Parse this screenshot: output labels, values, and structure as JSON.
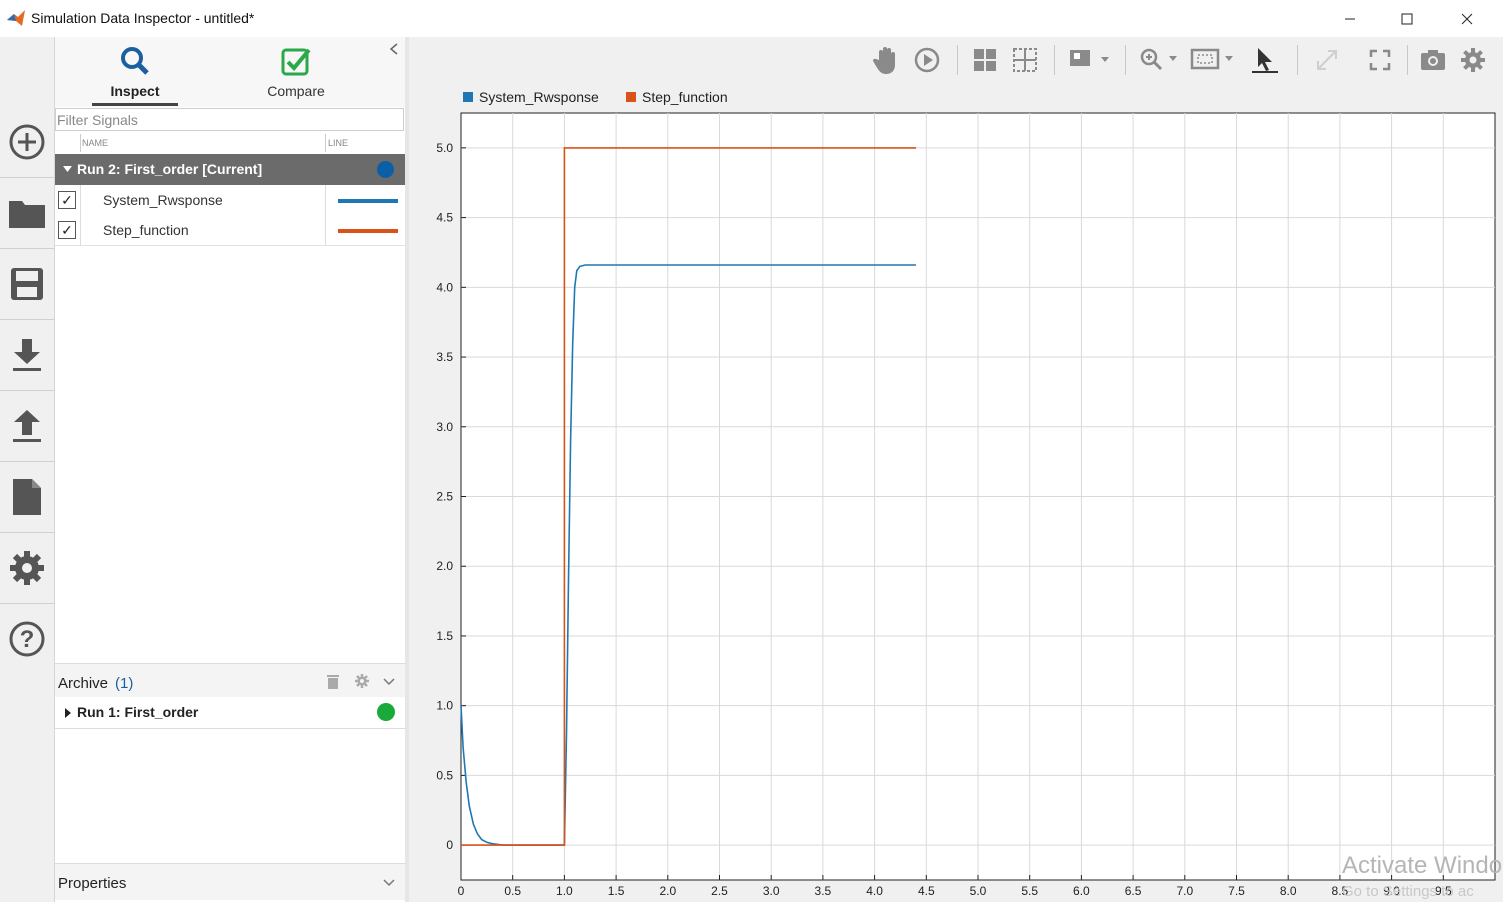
{
  "window": {
    "title": "Simulation Data Inspector - untitled*"
  },
  "tabs": [
    {
      "label": "Inspect"
    },
    {
      "label": "Compare"
    }
  ],
  "filter": {
    "placeholder": "Filter Signals"
  },
  "columns": {
    "name": "NAME",
    "line": "LINE"
  },
  "current_run": {
    "label": "Run 2: First_order [Current]",
    "color": "#0a5fa6",
    "signals": [
      {
        "name": "System_Rwsponse",
        "checked": true,
        "color": "#1f77b4"
      },
      {
        "name": "Step_function",
        "checked": true,
        "color": "#d95319"
      }
    ]
  },
  "archive": {
    "label": "Archive",
    "count": "(1)"
  },
  "archived_runs": [
    {
      "label": "Run 1: First_order",
      "color": "#1aaa3b"
    }
  ],
  "properties": {
    "label": "Properties"
  },
  "left_toolbar": [
    "new-run-icon",
    "open-folder-icon",
    "save-icon",
    "import-icon",
    "export-icon",
    "report-icon",
    "settings-icon",
    "help-icon"
  ],
  "plot_toolbar": [
    "pan-icon",
    "replay-icon",
    "layout-icon",
    "grid-icon",
    "subplot-icon",
    "zoom-icon",
    "fit-icon",
    "cursor-icon",
    "expand-icon",
    "fullscreen-icon",
    "snapshot-icon",
    "plot-settings-icon"
  ],
  "watermark": {
    "line1": "Activate Windo",
    "line2": "Go to Settings to ac"
  },
  "chart_data": {
    "type": "line",
    "title": "",
    "xlabel": "",
    "ylabel": "",
    "xlim": [
      0,
      10
    ],
    "ylim": [
      -0.25,
      5.25
    ],
    "x_ticks": [
      "0",
      "0.5",
      "1.0",
      "1.5",
      "2.0",
      "2.5",
      "3.0",
      "3.5",
      "4.0",
      "4.5",
      "5.0",
      "5.5",
      "6.0",
      "6.5",
      "7.0",
      "7.5",
      "8.0",
      "8.5",
      "9.0",
      "9.5"
    ],
    "y_ticks": [
      "0",
      "0.5",
      "1.0",
      "1.5",
      "2.0",
      "2.5",
      "3.0",
      "3.5",
      "4.0",
      "4.5",
      "5.0"
    ],
    "grid": true,
    "legend_position": "top-left",
    "series": [
      {
        "name": "System_Rwsponse",
        "color": "#1f77b4",
        "x": [
          0,
          0.02,
          0.05,
          0.08,
          0.12,
          0.16,
          0.2,
          0.25,
          0.3,
          0.4,
          1.0,
          1.02,
          1.04,
          1.06,
          1.08,
          1.1,
          1.12,
          1.15,
          1.2,
          1.5,
          2.0,
          2.5,
          3.0,
          3.5,
          4.0,
          4.4
        ],
        "y": [
          1.0,
          0.7,
          0.45,
          0.28,
          0.15,
          0.08,
          0.04,
          0.02,
          0.01,
          0.0,
          0.0,
          0.8,
          1.9,
          2.9,
          3.6,
          4.0,
          4.12,
          4.15,
          4.16,
          4.16,
          4.16,
          4.16,
          4.16,
          4.16,
          4.16,
          4.16
        ]
      },
      {
        "name": "Step_function",
        "color": "#d95319",
        "x": [
          0,
          1.0,
          1.0,
          4.4
        ],
        "y": [
          0,
          0,
          5.0,
          5.0
        ]
      }
    ]
  }
}
